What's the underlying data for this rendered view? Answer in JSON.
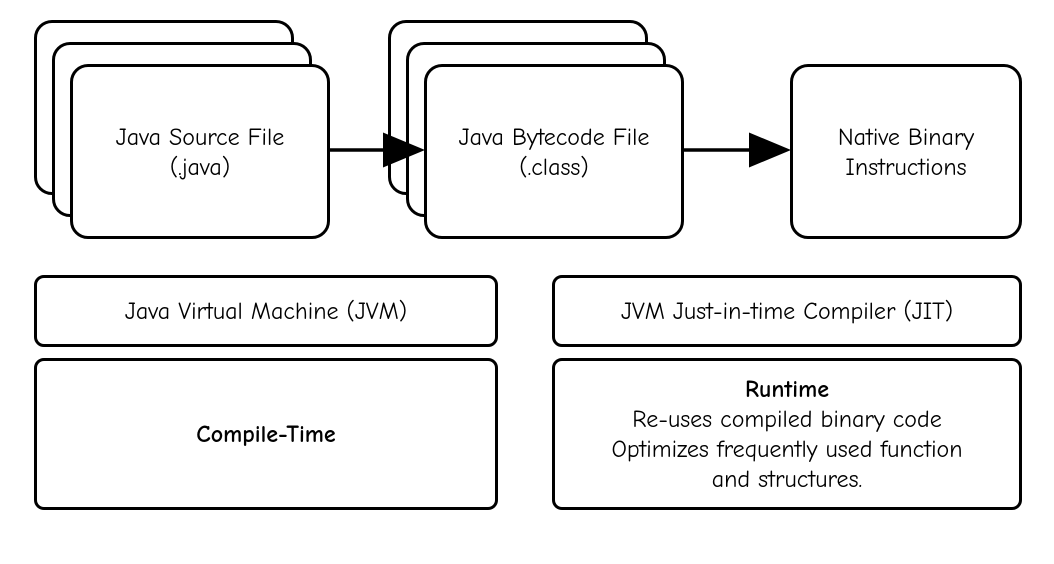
{
  "nodes": {
    "source": {
      "line1": "Java Source File",
      "line2": "(.java)"
    },
    "bytecode": {
      "line1": "Java Bytecode File",
      "line2": "(.class)"
    },
    "native": {
      "line1": "Native Binary",
      "line2": "Instructions"
    }
  },
  "bottom_left": {
    "top": "Java Virtual Machine (JVM)",
    "bottom_bold": "Compile-Time"
  },
  "bottom_right": {
    "top": "JVM Just-in-time Compiler (JIT)",
    "bold": "Runtime",
    "line2": "Re-uses compiled binary code",
    "line3": "Optimizes frequently used function",
    "line4": "and structures."
  }
}
